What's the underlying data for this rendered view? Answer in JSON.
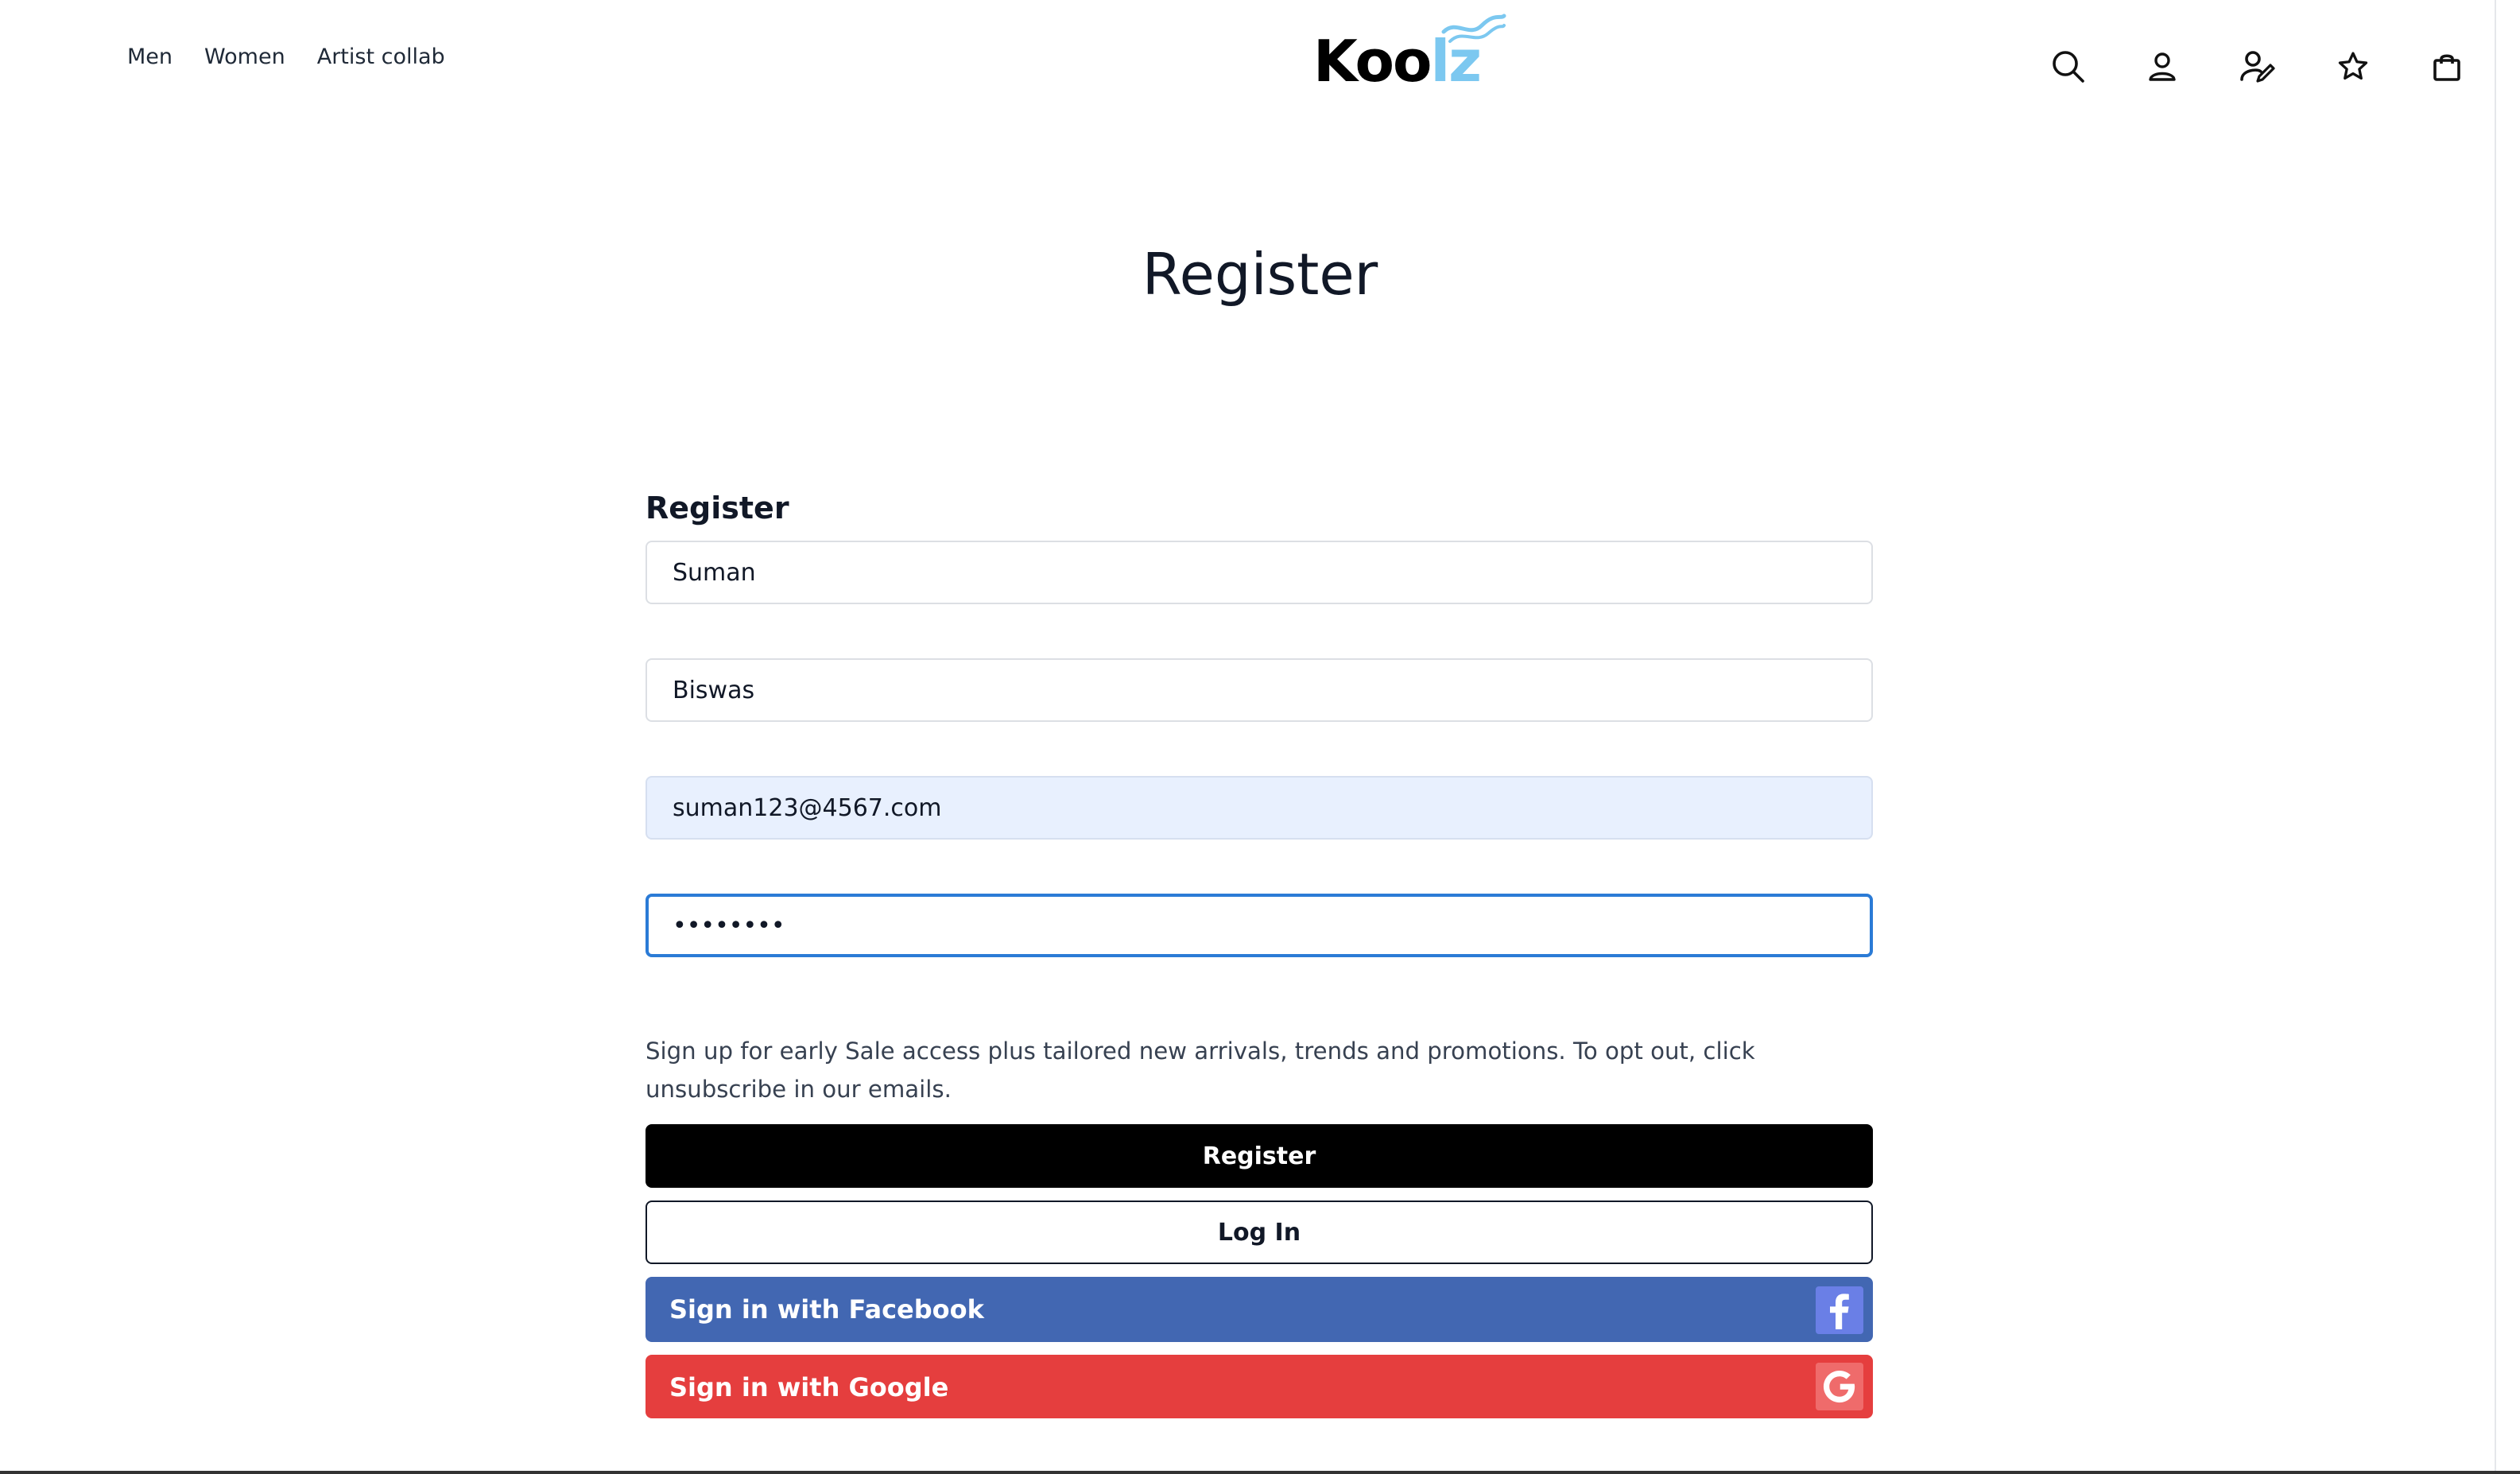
{
  "nav": {
    "items": [
      {
        "label": "Men"
      },
      {
        "label": "Women"
      },
      {
        "label": "Artist collab"
      }
    ]
  },
  "logo": {
    "part1": "Koo",
    "part2": "lz",
    "text_color": "#000000",
    "accent_color": "#7cc8f0"
  },
  "header_icons": [
    "search-icon",
    "user-icon",
    "user-edit-icon",
    "star-icon",
    "shopping-bag-icon"
  ],
  "page": {
    "title": "Register"
  },
  "form": {
    "label": "Register",
    "first_name": "Suman",
    "last_name": "Biswas",
    "email": "suman123@4567.com",
    "password": "••••••••",
    "consent_text": "Sign up for early Sale access plus tailored new arrivals, trends and promotions. To opt out, click unsubscribe in our emails.",
    "register_label": "Register",
    "login_label": "Log In",
    "facebook_label": "Sign in with Facebook",
    "google_label": "Sign in with Google"
  },
  "colors": {
    "facebook": "#4267b2",
    "google": "#e53e3e",
    "focus_border": "#2b7bd6",
    "autofill_bg": "#e8f0fe"
  }
}
